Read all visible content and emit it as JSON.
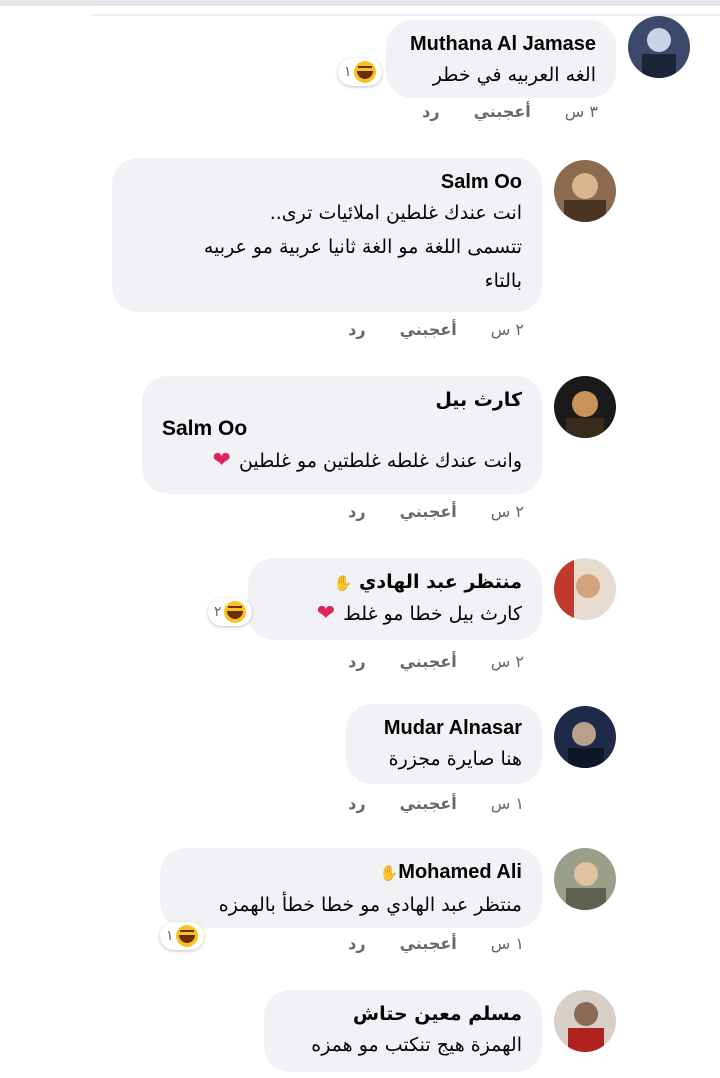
{
  "comments": [
    {
      "author": "Muthana Al Jamase",
      "text_lines": [
        "الغه العربيه في خطر"
      ],
      "time": "٣ س",
      "like": "أعجبني",
      "reply": "رد",
      "reaction_count": "١"
    },
    {
      "author": "Salm Oo",
      "text_lines": [
        "انت عندك غلطين املائيات ترى..",
        "تتسمى اللغة مو الغة ثانيا عربية مو عربيه",
        "بالتاء"
      ],
      "time": "٢ س",
      "like": "أعجبني",
      "reply": "رد"
    },
    {
      "author": "كارث بيل",
      "mention": "Salm Oo",
      "text_lines": [
        "وانت عندك غلطه غلطتين مو غلطين"
      ],
      "time": "٢ س",
      "like": "أعجبني",
      "reply": "رد"
    },
    {
      "author": "منتظر عبد الهادي",
      "text_lines": [
        "كارث بيل  خطا مو غلط"
      ],
      "time": "٢ س",
      "like": "أعجبني",
      "reply": "رد",
      "reaction_count": "٢"
    },
    {
      "author": "Mudar Alnasar",
      "text_lines": [
        "هنا صايرة مجزرة"
      ],
      "time": "١ س",
      "like": "أعجبني",
      "reply": "رد"
    },
    {
      "author": "Mohamed Ali",
      "text_lines": [
        "منتظر عبد الهادي مو خطا خطأ بالهمزه"
      ],
      "time": "١ س",
      "like": "أعجبني",
      "reply": "رد",
      "reaction_count": "١"
    },
    {
      "author": "مسلم معين حتاش",
      "text_lines": [
        "الهمزة هيج تنكتب مو همزه"
      ]
    }
  ],
  "colors": {
    "bubble": "#f0f2f5",
    "meta": "#65676b",
    "heart": "#e0245e",
    "haha": "#f7c324"
  }
}
